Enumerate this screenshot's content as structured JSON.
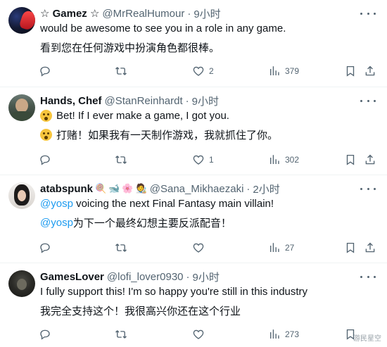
{
  "tweets": [
    {
      "name": "☆ Gamez ☆",
      "handle": "@MrRealHumour",
      "time": "9小时",
      "line1": "would be awesome to see you in a role in any game.",
      "line2": "看到您在任何游戏中扮演角色都很棒。",
      "likes": "2",
      "views": "379",
      "avatar": "avatar-red-figure"
    },
    {
      "name": "Hands, Chef",
      "handle": "@StanReinhardt",
      "time": "9小时",
      "line1": "Bet! If I ever make a game, I got you.",
      "line2": "打赌！如果我有一天制作游戏，我就抓住了你。",
      "likes": "1",
      "views": "302",
      "avatar": "avatar-armored-man"
    },
    {
      "name": "atabspunk",
      "badges": [
        "🍭",
        "🐋",
        "🌸",
        "🧑‍🎨"
      ],
      "handle": "@Sana_Mikhaezaki",
      "time": "2小时",
      "mention1": "@yosp",
      "line1": " voicing the next Final Fantasy main villain!",
      "mention2": "@yosp",
      "line2": "为下一个最终幻想主要反派配音！",
      "views": "27",
      "avatar": "avatar-woman-dark-hair"
    },
    {
      "name": "GamesLover",
      "handle": "@lofi_lover0930",
      "time": "9小时",
      "line1": "I fully support this! I'm so happy you're still in this industry",
      "line2": "我完全支持这个！我很高兴你还在这个行业",
      "views": "273",
      "avatar": "avatar-dark-figure"
    }
  ],
  "separator": "·",
  "watermark": "游民星空",
  "colors": {
    "text": "#0f1419",
    "muted": "#536471",
    "link": "#1d9bf0",
    "border": "#eff3f4"
  },
  "icons": [
    "reply-icon",
    "retweet-icon",
    "like-icon",
    "views-icon",
    "bookmark-icon",
    "share-icon",
    "more-icon"
  ]
}
